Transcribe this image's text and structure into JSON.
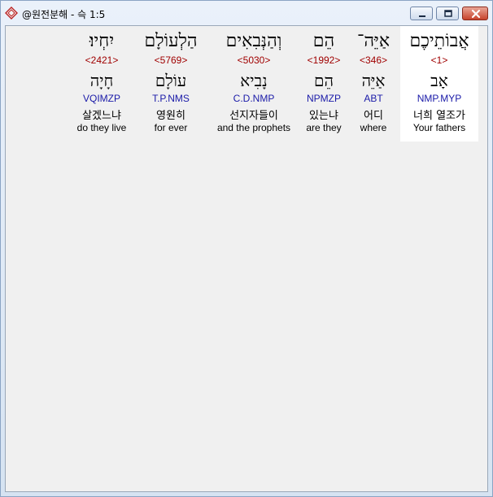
{
  "window": {
    "title": "@원전분해 - 슥 1:5",
    "app_icon": "book-diamond-icon",
    "controls": {
      "minimize": "minimize-icon",
      "maximize": "maximize-icon",
      "close": "close-icon"
    }
  },
  "words": [
    {
      "hebrew": "אֲבוֹתֵיכֶם",
      "strong": "<1>",
      "lemma": "אָב",
      "morph": "NMP.MYP",
      "korean": "너희 열조가",
      "english": "Your fathers",
      "selected": true
    },
    {
      "hebrew": "אַיֵּה־",
      "strong": "<346>",
      "lemma": "אַיֵּה",
      "morph": "ABT",
      "korean": "어디",
      "english": "where",
      "selected": false
    },
    {
      "hebrew": "הֵם",
      "strong": "<1992>",
      "lemma": "הֵם",
      "morph": "NPMZP",
      "korean": "있는냐",
      "english": "are they",
      "selected": false
    },
    {
      "hebrew": "וְהַנְּבִאִים",
      "strong": "<5030>",
      "lemma": "נָבִיא",
      "morph": "C.D.NMP",
      "korean": "선지자들이",
      "english": "and the prophets",
      "selected": false
    },
    {
      "hebrew": "הַלְעוֹלָם",
      "strong": "<5769>",
      "lemma": "עוֹלָם",
      "morph": "T.P.NMS",
      "korean": "영원히",
      "english": "for ever",
      "selected": false
    },
    {
      "hebrew": "יִחְיוּ׃",
      "strong": "<2421>",
      "lemma": "חָיָה",
      "morph": "VQIMZP",
      "korean": "살겠느냐",
      "english": "do they live",
      "selected": false
    }
  ]
}
